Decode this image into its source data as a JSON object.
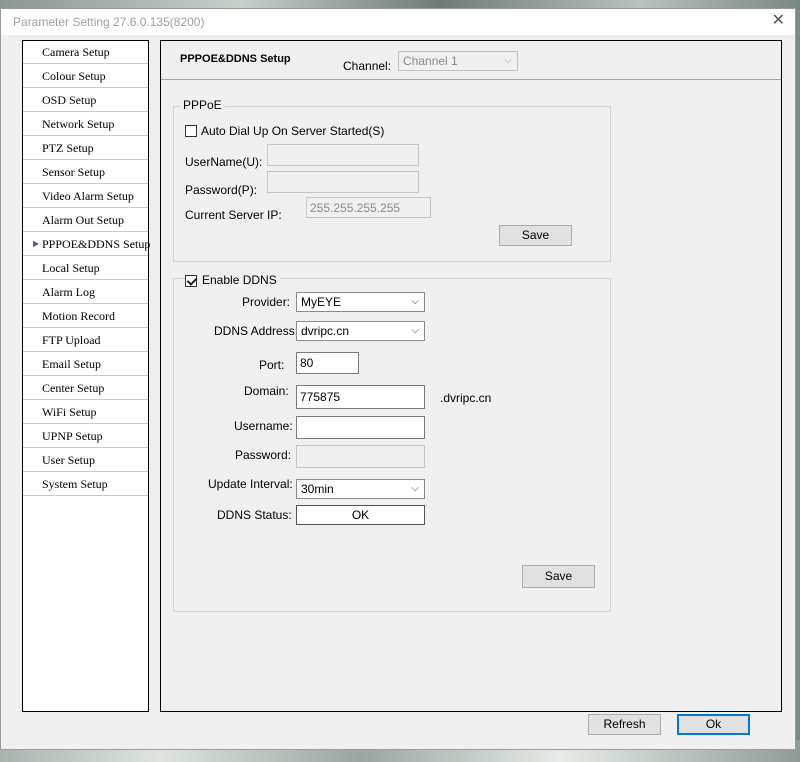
{
  "window": {
    "title": "Parameter Setting 27.6.0.135(8200)",
    "close_glyph": "✕"
  },
  "sidebar": {
    "active_index": 8,
    "items": [
      {
        "label": "Camera Setup"
      },
      {
        "label": "Colour Setup"
      },
      {
        "label": "OSD Setup"
      },
      {
        "label": "Network Setup"
      },
      {
        "label": "PTZ Setup"
      },
      {
        "label": "Sensor Setup"
      },
      {
        "label": "Video Alarm Setup"
      },
      {
        "label": "Alarm Out Setup"
      },
      {
        "label": "PPPOE&DDNS Setup"
      },
      {
        "label": "Local Setup"
      },
      {
        "label": "Alarm Log"
      },
      {
        "label": "Motion Record"
      },
      {
        "label": "FTP Upload"
      },
      {
        "label": "Email Setup"
      },
      {
        "label": "Center Setup"
      },
      {
        "label": "WiFi Setup"
      },
      {
        "label": "UPNP Setup"
      },
      {
        "label": "User Setup"
      },
      {
        "label": "System Setup"
      }
    ]
  },
  "panel": {
    "title": "PPPOE&DDNS Setup",
    "channel_label": "Channel:",
    "channel_value": "Channel 1"
  },
  "pppoe": {
    "legend": "PPPoE",
    "auto_dial_label": "Auto Dial Up On Server Started(S)",
    "auto_dial_checked": false,
    "username_label": "UserName(U):",
    "username_value": "",
    "password_label": "Password(P):",
    "password_value": "",
    "server_ip_label": "Current Server IP:",
    "server_ip_value": "255.255.255.255",
    "save_label": "Save"
  },
  "ddns": {
    "enable_label": "Enable DDNS",
    "enable_checked": true,
    "provider_label": "Provider:",
    "provider_value": "MyEYE",
    "address_label": "DDNS Address:",
    "address_value": "dvripc.cn",
    "port_label": "Port:",
    "port_value": "80",
    "domain_label": "Domain:",
    "domain_value": "775875",
    "domain_suffix": ".dvripc.cn",
    "username_label": "Username:",
    "username_value": "",
    "password_label": "Password:",
    "password_value": "",
    "interval_label": "Update Interval:",
    "interval_value": "30min",
    "status_label": "DDNS Status:",
    "status_value": "OK",
    "save_label": "Save"
  },
  "footer": {
    "refresh_label": "Refresh",
    "ok_label": "Ok"
  },
  "icons": {
    "chevron": "⌵",
    "arrow": "▶"
  }
}
